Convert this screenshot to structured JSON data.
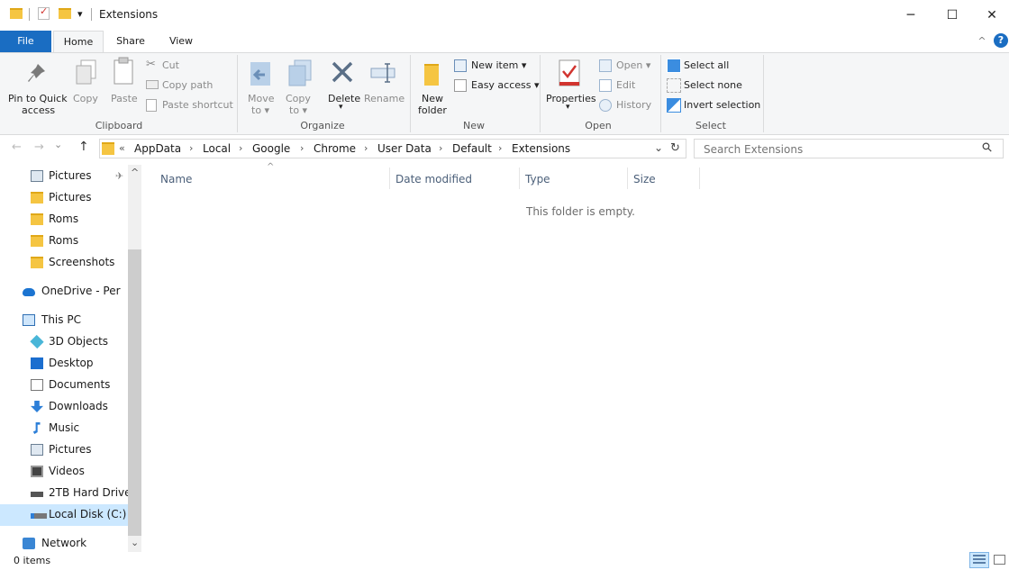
{
  "window": {
    "title": "Extensions",
    "qat_dropdown": "▾",
    "minimize": "─",
    "maximize": "☐",
    "close": "✕"
  },
  "ribbon_tabs": {
    "file": "File",
    "home": "Home",
    "share": "Share",
    "view": "View",
    "collapse": "^",
    "help": "?"
  },
  "clipboard": {
    "pin_label_1": "Pin to Quick",
    "pin_label_2": "access",
    "copy": "Copy",
    "paste": "Paste",
    "cut": "Cut",
    "copy_path": "Copy path",
    "paste_shortcut": "Paste shortcut",
    "group": "Clipboard"
  },
  "organize": {
    "move_1": "Move",
    "move_2": "to ▾",
    "copy_1": "Copy",
    "copy_2": "to ▾",
    "delete": "Delete",
    "delete_arrow": "▾",
    "rename": "Rename",
    "group": "Organize"
  },
  "new": {
    "new_folder_1": "New",
    "new_folder_2": "folder",
    "new_item": "New item ▾",
    "easy_access": "Easy access ▾",
    "group": "New"
  },
  "open": {
    "properties": "Properties",
    "properties_arrow": "▾",
    "open": "Open ▾",
    "edit": "Edit",
    "history": "History",
    "group": "Open"
  },
  "select": {
    "select_all": "Select all",
    "select_none": "Select none",
    "invert": "Invert selection",
    "group": "Select"
  },
  "address": {
    "back": "←",
    "forward": "→",
    "history": "⌄",
    "up": "↑",
    "overflow": "«",
    "crumbs": [
      "AppData",
      "Local",
      "Google",
      "Chrome",
      "User Data",
      "Default",
      "Extensions"
    ],
    "separator": "›",
    "dropdown": "⌄",
    "refresh": "↻"
  },
  "search": {
    "placeholder": "Search Extensions",
    "icon": "⚲"
  },
  "nav": {
    "scroll_up": "^",
    "scroll_down": "⌄",
    "items": [
      {
        "label": "Pictures",
        "icon": "pictures-icon",
        "pinned": true
      },
      {
        "label": "Pictures",
        "icon": "folder-icon"
      },
      {
        "label": "Roms",
        "icon": "folder-icon"
      },
      {
        "label": "Roms",
        "icon": "folder-icon"
      },
      {
        "label": "Screenshots",
        "icon": "folder-icon"
      },
      {
        "label": "OneDrive - Perso",
        "icon": "onedrive-icon"
      },
      {
        "label": "This PC",
        "icon": "pc-icon"
      },
      {
        "label": "3D Objects",
        "icon": "3d-objects-icon"
      },
      {
        "label": "Desktop",
        "icon": "desktop-icon"
      },
      {
        "label": "Documents",
        "icon": "documents-icon"
      },
      {
        "label": "Downloads",
        "icon": "downloads-icon"
      },
      {
        "label": "Music",
        "icon": "music-icon"
      },
      {
        "label": "Pictures",
        "icon": "pictures-icon"
      },
      {
        "label": "Videos",
        "icon": "videos-icon"
      },
      {
        "label": "2TB Hard Drive",
        "icon": "drive-icon"
      },
      {
        "label": "Local Disk (C:)",
        "icon": "local-disk-icon",
        "selected": true
      },
      {
        "label": "Network",
        "icon": "network-icon"
      }
    ],
    "pin_glyph": "📌"
  },
  "columns": {
    "name": "Name",
    "date_modified": "Date modified",
    "type": "Type",
    "size": "Size",
    "sort_indicator": "^"
  },
  "content": {
    "empty_message": "This folder is empty."
  },
  "status": {
    "items": "0 items"
  },
  "colors": {
    "file_tab": "#1a6dc2",
    "selection": "#cce8ff",
    "folder": "#f5c542"
  }
}
